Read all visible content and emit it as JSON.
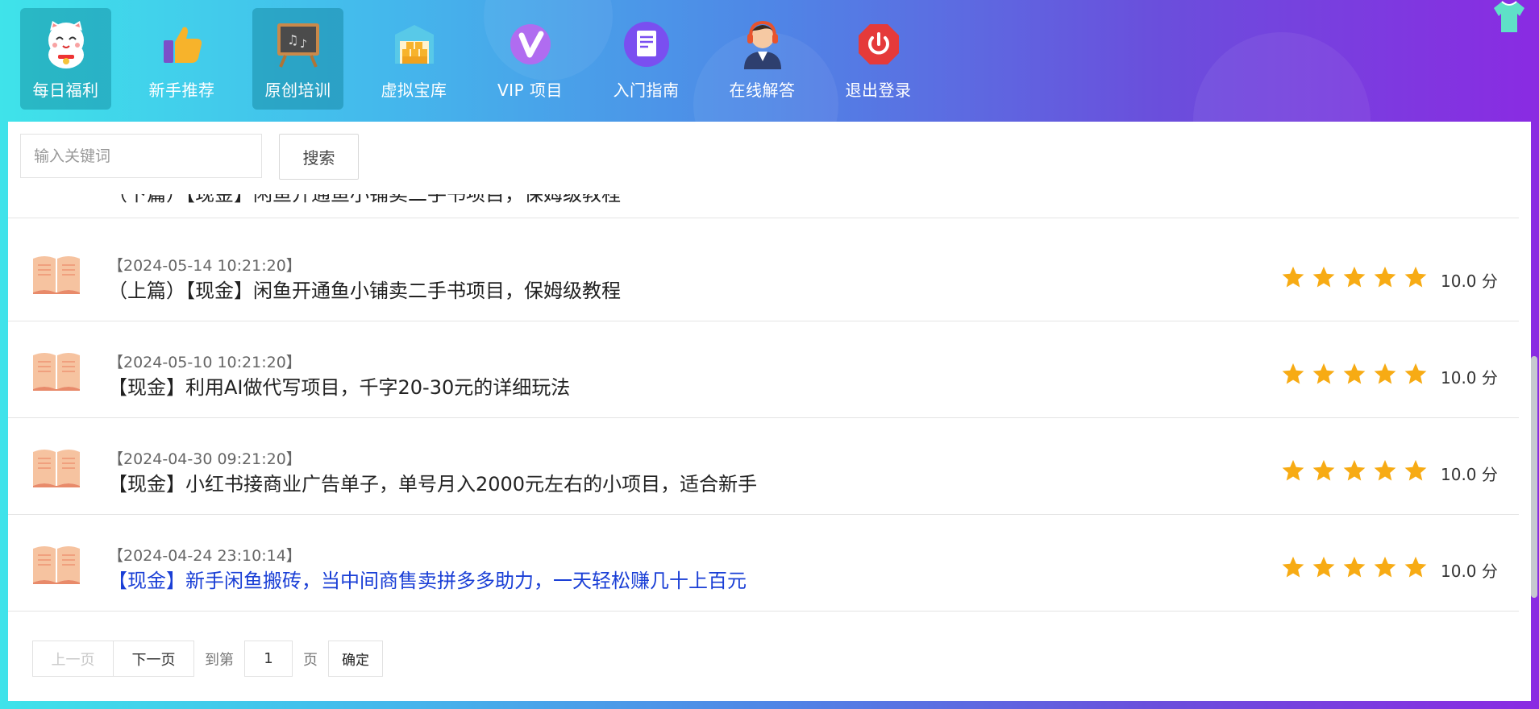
{
  "nav": [
    {
      "label": "每日福利",
      "icon": "lucky-cat-icon",
      "active": true
    },
    {
      "label": "新手推荐",
      "icon": "thumbs-up-icon",
      "active": false
    },
    {
      "label": "原创培训",
      "icon": "blackboard-icon",
      "active": true
    },
    {
      "label": "虚拟宝库",
      "icon": "treasure-house-icon",
      "active": false
    },
    {
      "label": "VIP 项目",
      "icon": "vip-icon",
      "active": false
    },
    {
      "label": "入门指南",
      "icon": "document-icon",
      "active": false
    },
    {
      "label": "在线解答",
      "icon": "headset-agent-icon",
      "active": false
    },
    {
      "label": "退出登录",
      "icon": "power-icon",
      "active": false
    }
  ],
  "search": {
    "placeholder": "输入关键词",
    "button": "搜索"
  },
  "partial_title": "（下篇）【现金】闲鱼开通鱼小铺卖二手书项目，保姆级教程",
  "items": [
    {
      "date": "【2024-05-14 10:21:20】",
      "title": "（上篇）【现金】闲鱼开通鱼小铺卖二手书项目，保姆级教程",
      "score": "10.0 分",
      "rating": 5
    },
    {
      "date": "【2024-05-10 10:21:20】",
      "title": "【现金】利用AI做代写项目，千字20-30元的详细玩法",
      "score": "10.0 分",
      "rating": 5
    },
    {
      "date": "【2024-04-30 09:21:20】",
      "title": "【现金】小红书接商业广告单子，单号月入2000元左右的小项目，适合新手",
      "score": "10.0 分",
      "rating": 5
    },
    {
      "date": "【2024-04-24 23:10:14】",
      "title": "【现金】新手闲鱼搬砖，当中间商售卖拼多多助力，一天轻松赚几十上百元",
      "score": "10.0 分",
      "rating": 5
    }
  ],
  "pager": {
    "prev": "上一页",
    "next": "下一页",
    "goto": "到第",
    "page": "1",
    "unit": "页",
    "confirm": "确定"
  },
  "colors": {
    "star": "#f7ab14",
    "link": "#1a3fd6",
    "book": "#f2a07a"
  }
}
